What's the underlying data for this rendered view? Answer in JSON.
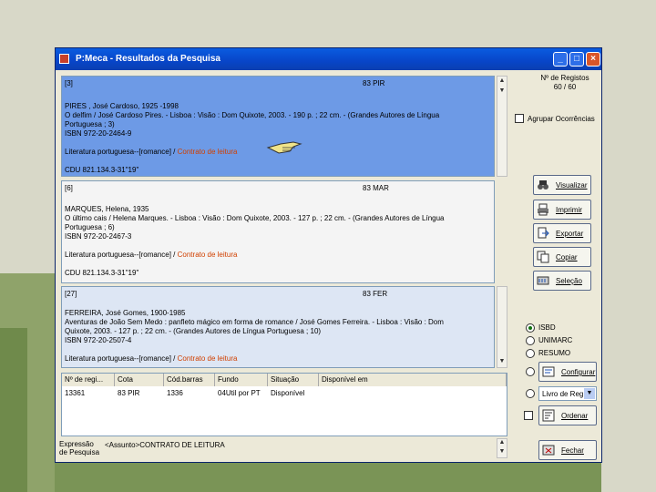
{
  "window": {
    "title": "P:Meca - Resultados da Pesquisa"
  },
  "registos": {
    "label": "Nº de Registos",
    "value": "60 / 60"
  },
  "agrupar": {
    "label": "Agrupar Ocorrências"
  },
  "records": [
    {
      "num": "[3]",
      "call": "83 PIR",
      "lines": [
        "PIRES , José Cardoso, 1925 -1998",
        "O delfim / José Cardoso Pires. - Lisboa : Visão : Dom Quixote, 2003. - 190 p. ; 22 cm. - (Grandes Autores de Língua",
        "Portuguesa ; 3)",
        "ISBN 972-20-2464-9"
      ],
      "subject_prefix": "Literatura portuguesa--[romance] / ",
      "subject_link": "Contrato de leitura",
      "cdu": "CDU 821.134.3-31\"19\""
    },
    {
      "num": "[6]",
      "call": "83 MAR",
      "lines": [
        "MARQUES, Helena, 1935",
        "O último cais / Helena Marques. - Lisboa : Visão : Dom Quixote, 2003. - 127 p. ; 22 cm. - (Grandes Autores de Língua",
        "Portuguesa ; 6)",
        "ISBN 972-20-2467-3"
      ],
      "subject_prefix": "Literatura portuguesa--[romance] / ",
      "subject_link": "Contrato de leitura",
      "cdu": "CDU 821.134.3-31\"19\""
    },
    {
      "num": "[27]",
      "call": "83 FER",
      "lines": [
        "FERREIRA, José Gomes, 1900-1985",
        "Aventuras de João Sem Medo : panfleto mágico em forma de romance / José Gomes Ferreira. - Lisboa : Visão : Dom",
        "Quixote, 2003. - 127 p. ; 22 cm. - (Grandes Autores de Língua Portuguesa ; 10)",
        "ISBN 972-20-2507-4"
      ],
      "subject_prefix": "Literatura portuguesa--[romance] / ",
      "subject_link": "Contrato de leitura",
      "cdu": ""
    }
  ],
  "buttons": {
    "visualizar": "Visualizar",
    "imprimir": "Imprimir",
    "exportar": "Exportar",
    "copiar": "Copiar",
    "selecao": "Seleção",
    "configurar": "Configurar",
    "ordenar": "Ordenar",
    "fechar": "Fechar"
  },
  "formats": [
    "ISBD",
    "UNIMARC",
    "RESUMO"
  ],
  "format_select": "Livro de Reg",
  "table": {
    "headers": [
      "Nº de regi...",
      "Cota",
      "Cód.barras",
      "Fundo",
      "Situação",
      "Disponível em"
    ],
    "rows": [
      [
        "13361",
        "83 PIR",
        "1336",
        "04Util por PT",
        "Disponível",
        ""
      ]
    ]
  },
  "expr": {
    "label1": "Expressão",
    "label2": "de Pesquisa",
    "value": "<Assunto>CONTRATO DE LEITURA"
  }
}
